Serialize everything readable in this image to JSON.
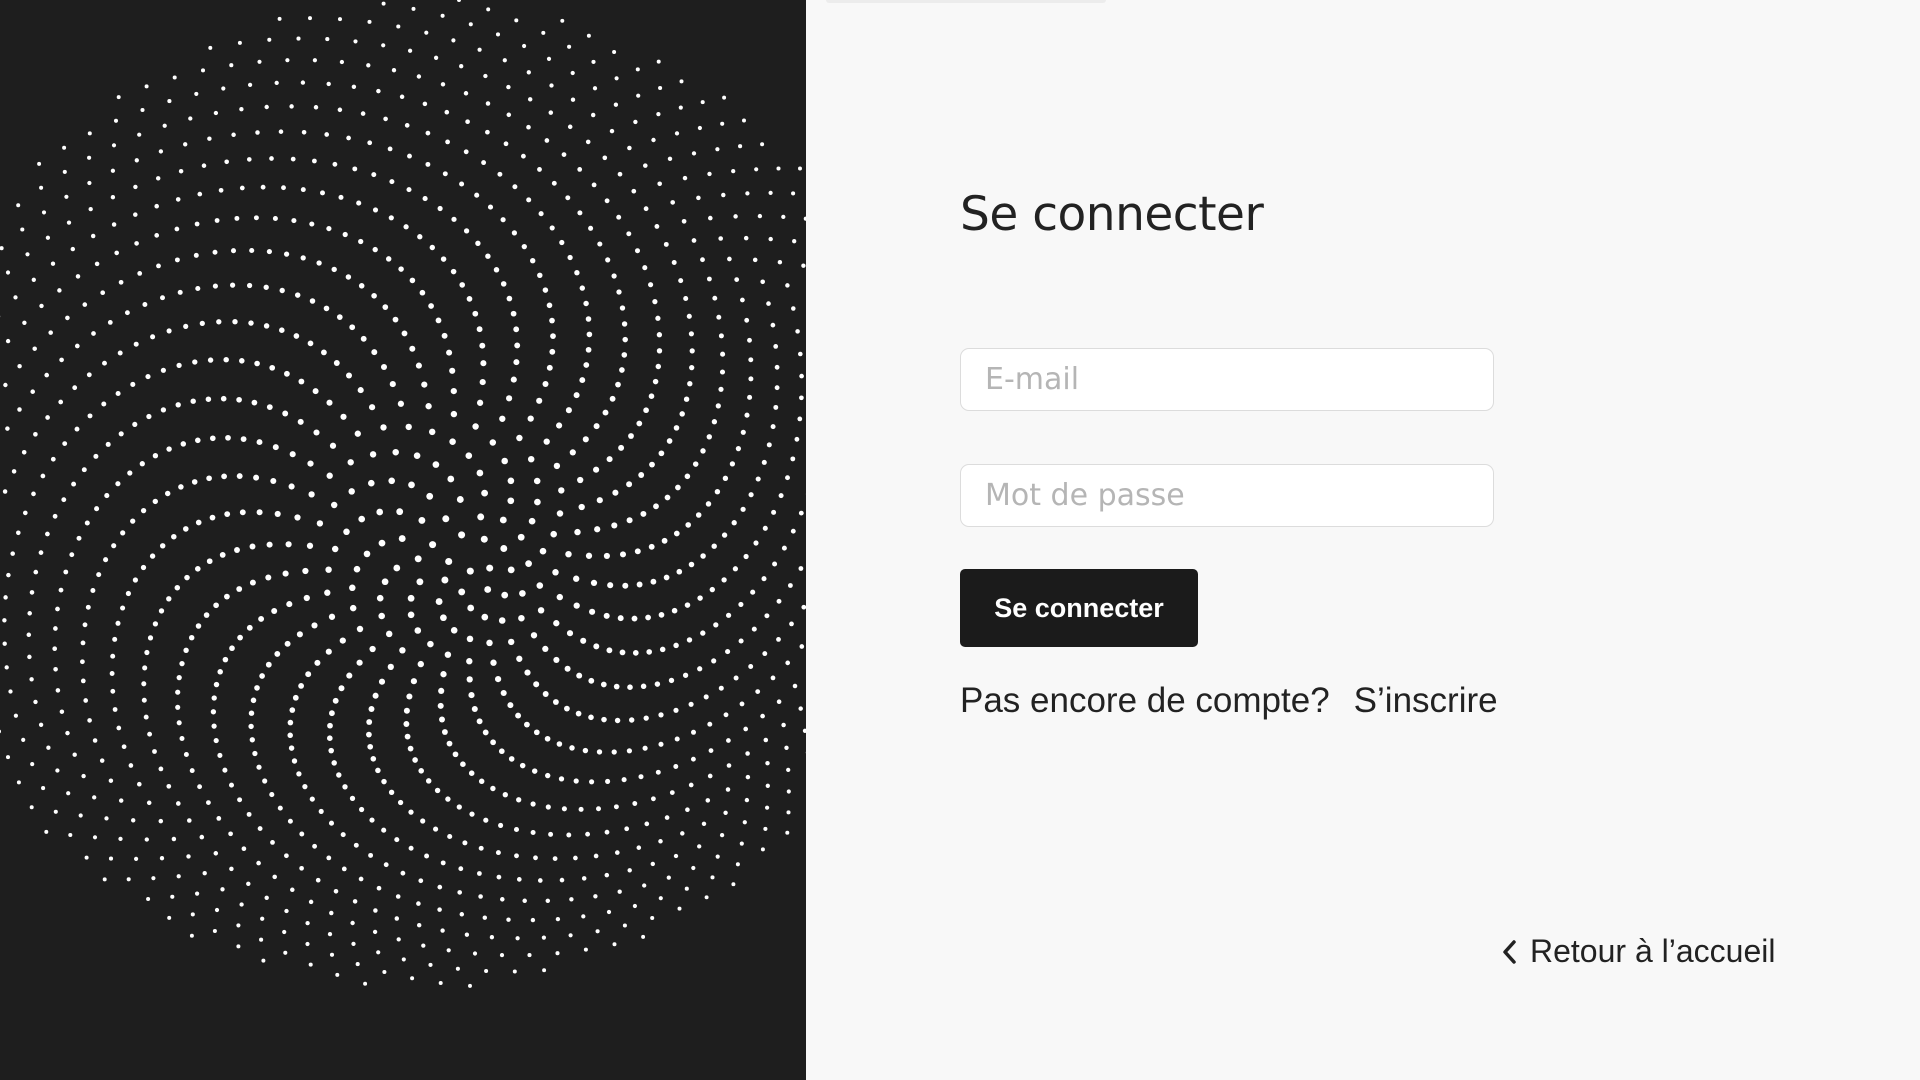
{
  "login": {
    "title": "Se connecter",
    "email_placeholder": "E-mail",
    "password_placeholder": "Mot de passe",
    "submit_label": "Se connecter",
    "no_account_text": "Pas encore de compte?",
    "signup_label": "S’inscrire",
    "back_label": "Retour à l’accueil"
  },
  "artwork": {
    "description": "spiral-dots"
  },
  "colors": {
    "art_background": "#1e1e1e",
    "page_background": "#f8f8f8",
    "button_background": "#1b1b1b",
    "text": "#222222"
  },
  "icons": {
    "back": "chevron-left-icon"
  }
}
